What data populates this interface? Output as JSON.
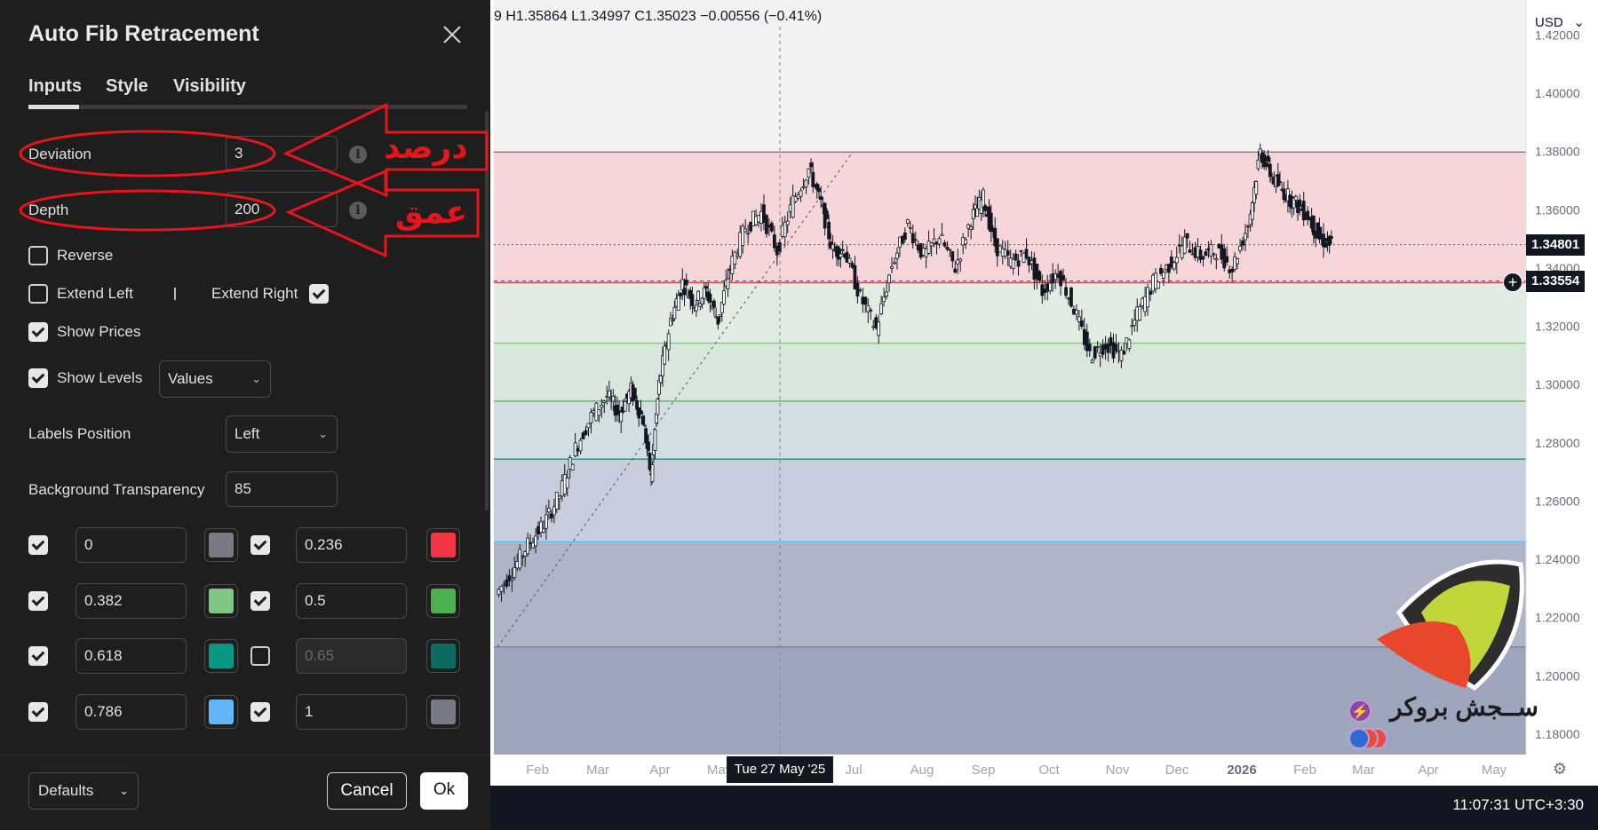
{
  "dialog": {
    "title": "Auto Fib Retracement",
    "tabs": [
      "Inputs",
      "Style",
      "Visibility"
    ],
    "active_tab": "Inputs",
    "deviation": {
      "label": "Deviation",
      "value": "3"
    },
    "depth": {
      "label": "Depth",
      "value": "200"
    },
    "reverse": {
      "label": "Reverse",
      "checked": false
    },
    "extend_left": {
      "label": "Extend Left",
      "checked": false
    },
    "extend_right": {
      "label": "Extend Right",
      "checked": true
    },
    "show_prices": {
      "label": "Show Prices",
      "checked": true
    },
    "show_levels": {
      "label": "Show Levels",
      "checked": true,
      "value": "Values"
    },
    "labels_position": {
      "label": "Labels Position",
      "value": "Left"
    },
    "background_transparency": {
      "label": "Background Transparency",
      "value": "85"
    },
    "levels": [
      {
        "checked": true,
        "value": "0",
        "color": "#787b86"
      },
      {
        "checked": true,
        "value": "0.236",
        "color": "#f23645"
      },
      {
        "checked": true,
        "value": "0.382",
        "color": "#81c784"
      },
      {
        "checked": true,
        "value": "0.5",
        "color": "#4caf50"
      },
      {
        "checked": true,
        "value": "0.618",
        "color": "#089981"
      },
      {
        "checked": false,
        "value": "0.65",
        "color": "#0b6b5e"
      },
      {
        "checked": true,
        "value": "0.786",
        "color": "#64b5f6"
      },
      {
        "checked": true,
        "value": "1",
        "color": "#787b86"
      }
    ],
    "footer": {
      "defaults": "Defaults",
      "cancel": "Cancel",
      "ok": "Ok"
    }
  },
  "annotations": {
    "deviation_note": "درصد",
    "depth_note": "عمق",
    "color": "#e8141c"
  },
  "chart": {
    "ohlc": "9 H1.35864 L1.34997 C1.35023 −0.00556 (−0.41%)",
    "currency": "USD",
    "last_price": "1.34801",
    "crosshair_price": "1.33554",
    "crosshair_date": "Tue 27 May '25",
    "time": "11:07:31 UTC+3:30",
    "broker_text": "ســجش بروکر"
  },
  "chart_data": {
    "type": "line",
    "subtype": "candlestick with fibonacci retracement bands",
    "x_ticks": [
      "Feb",
      "Mar",
      "Apr",
      "May",
      "Jul",
      "Aug",
      "Sep",
      "Oct",
      "Nov",
      "Dec",
      "2026",
      "Feb",
      "Mar",
      "Apr",
      "May"
    ],
    "y_ticks": [
      "1.42000",
      "1.40000",
      "1.38000",
      "1.36000",
      "1.34000",
      "1.32000",
      "1.30000",
      "1.28000",
      "1.26000",
      "1.24000",
      "1.22000",
      "1.20000",
      "1.18000"
    ],
    "ylim": [
      1.17,
      1.43
    ],
    "fib_levels": [
      {
        "level": "0",
        "price": 1.3798,
        "color": "#787b86"
      },
      {
        "level": "0.236",
        "price": 1.335,
        "color": "#f23645"
      },
      {
        "level": "0.382",
        "price": 1.3142,
        "color": "#81c784"
      },
      {
        "level": "0.5",
        "price": 1.2943,
        "color": "#4caf50"
      },
      {
        "level": "0.618",
        "price": 1.2744,
        "color": "#089981"
      },
      {
        "level": "0.786",
        "price": 1.246,
        "color": "#64b5f6"
      },
      {
        "level": "1",
        "price": 1.2099,
        "color": "#787b86"
      }
    ],
    "price_path": [
      [
        0,
        1.228
      ],
      [
        4,
        1.236
      ],
      [
        8,
        1.245
      ],
      [
        12,
        1.252
      ],
      [
        16,
        1.262
      ],
      [
        20,
        1.278
      ],
      [
        24,
        1.289
      ],
      [
        28,
        1.296
      ],
      [
        31,
        1.29
      ],
      [
        34,
        1.298
      ],
      [
        37,
        1.288
      ],
      [
        39,
        1.268
      ],
      [
        41,
        1.3
      ],
      [
        44,
        1.322
      ],
      [
        47,
        1.335
      ],
      [
        50,
        1.328
      ],
      [
        53,
        1.332
      ],
      [
        56,
        1.322
      ],
      [
        59,
        1.34
      ],
      [
        63,
        1.354
      ],
      [
        67,
        1.359
      ],
      [
        71,
        1.346
      ],
      [
        75,
        1.363
      ],
      [
        79,
        1.374
      ],
      [
        82,
        1.362
      ],
      [
        85,
        1.346
      ],
      [
        88,
        1.346
      ],
      [
        92,
        1.33
      ],
      [
        96,
        1.319
      ],
      [
        100,
        1.341
      ],
      [
        104,
        1.355
      ],
      [
        108,
        1.344
      ],
      [
        112,
        1.351
      ],
      [
        116,
        1.34
      ],
      [
        120,
        1.357
      ],
      [
        123,
        1.364
      ],
      [
        126,
        1.348
      ],
      [
        130,
        1.342
      ],
      [
        134,
        1.345
      ],
      [
        138,
        1.332
      ],
      [
        142,
        1.339
      ],
      [
        146,
        1.326
      ],
      [
        150,
        1.31
      ],
      [
        154,
        1.314
      ],
      [
        158,
        1.31
      ],
      [
        162,
        1.324
      ],
      [
        166,
        1.335
      ],
      [
        170,
        1.341
      ],
      [
        174,
        1.349
      ],
      [
        178,
        1.344
      ],
      [
        182,
        1.346
      ],
      [
        186,
        1.34
      ],
      [
        190,
        1.355
      ],
      [
        193,
        1.38
      ],
      [
        196,
        1.371
      ],
      [
        199,
        1.366
      ],
      [
        202,
        1.362
      ],
      [
        205,
        1.358
      ],
      [
        208,
        1.35
      ],
      [
        211,
        1.348
      ]
    ]
  }
}
